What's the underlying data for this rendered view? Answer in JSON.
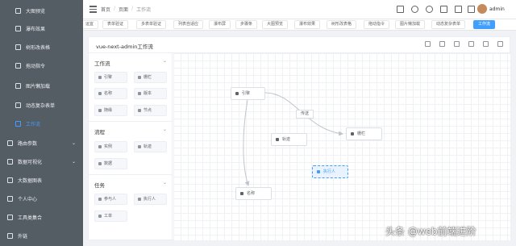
{
  "sidebar": {
    "items": [
      {
        "label": "大图预览",
        "icon": "image-icon",
        "level": 2
      },
      {
        "label": "瀑布效果",
        "icon": "grid-icon",
        "level": 2
      },
      {
        "label": "树形改表格",
        "icon": "tree-icon",
        "level": 2
      },
      {
        "label": "拖动指令",
        "icon": "drag-icon",
        "level": 2
      },
      {
        "label": "图片懒加载",
        "icon": "picture-icon",
        "level": 2
      },
      {
        "label": "动态复杂表单",
        "icon": "form-icon",
        "level": 2
      },
      {
        "label": "工作流",
        "icon": "workflow-icon",
        "level": 2,
        "active": true
      },
      {
        "label": "路由参数",
        "icon": "route-icon",
        "level": 1,
        "expandable": true
      },
      {
        "label": "数据可视化",
        "icon": "chart-icon",
        "level": 1,
        "expandable": true
      },
      {
        "label": "大数据图表",
        "icon": "bigdata-icon",
        "level": 1
      },
      {
        "label": "个人中心",
        "icon": "user-icon",
        "level": 1
      },
      {
        "label": "工具类集合",
        "icon": "tools-icon",
        "level": 1
      },
      {
        "label": "外链",
        "icon": "link-icon",
        "level": 1
      }
    ],
    "colors": {
      "background": "#545c64",
      "text": "#eef0f3",
      "active": "#409eff"
    }
  },
  "header": {
    "breadcrumb": [
      "首页",
      "页面",
      "工作流"
    ],
    "separator": "/",
    "icons": [
      "translate-icon",
      "component-size-icon",
      "search-icon",
      "theme-icon",
      "bell-icon",
      "fullscreen-icon"
    ],
    "username": "admin"
  },
  "tags": [
    {
      "label": "运宜"
    },
    {
      "label": "表单验证"
    },
    {
      "label": "多表单验证"
    },
    {
      "label": "列表自适应"
    },
    {
      "label": "瀑布屏"
    },
    {
      "label": "步骤条"
    },
    {
      "label": "大图预览"
    },
    {
      "label": "瀑布效果"
    },
    {
      "label": "树形改表格"
    },
    {
      "label": "拖动指令"
    },
    {
      "label": "图片懒加载"
    },
    {
      "label": "动态复杂表单"
    },
    {
      "label": "工作流",
      "active": true
    }
  ],
  "panel": {
    "title": "vue-next-admin工作流",
    "tools": [
      "help-icon",
      "download-icon",
      "check-icon",
      "submit-icon",
      "delete-icon",
      "fullscreen-icon"
    ]
  },
  "palette": {
    "groups": [
      {
        "title": "工作流",
        "nodes": [
          {
            "label": "引擎",
            "icon": "user-icon"
          },
          {
            "label": "栅栏",
            "icon": "pin-icon"
          },
          {
            "label": "名称",
            "icon": "building-icon"
          },
          {
            "label": "版本",
            "icon": "doc-icon"
          },
          {
            "label": "随缘",
            "icon": "screen-icon"
          },
          {
            "label": "节点",
            "icon": "node-icon"
          }
        ]
      },
      {
        "title": "流程",
        "nodes": [
          {
            "label": "实例",
            "icon": "share-icon"
          },
          {
            "label": "轨迹",
            "icon": "database-icon"
          },
          {
            "label": "数据",
            "icon": "box-icon"
          }
        ]
      },
      {
        "title": "任务",
        "nodes": [
          {
            "label": "参与人",
            "icon": "flag-icon"
          },
          {
            "label": "执行人",
            "icon": "chat-icon"
          },
          {
            "label": "工单",
            "icon": "ticket-icon"
          }
        ]
      }
    ]
  },
  "flow": {
    "nodes": [
      {
        "label": "引擎",
        "icon": "user-icon"
      },
      {
        "label": "栅栏",
        "icon": "pin-icon"
      },
      {
        "label": "轨迹",
        "icon": "database-icon"
      },
      {
        "label": "执行人",
        "icon": "chat-icon",
        "selected": true
      },
      {
        "label": "名称",
        "icon": "building-icon"
      }
    ],
    "edge_label": "传送"
  },
  "watermark": "头条 @web前端进阶"
}
